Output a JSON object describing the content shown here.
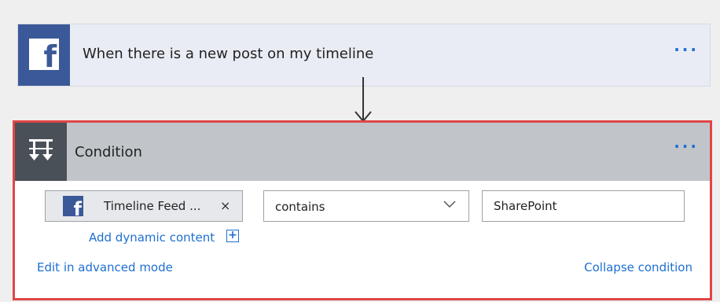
{
  "trigger": {
    "title": "When there is a new post on my timeline",
    "icon": "facebook-icon",
    "more": "···"
  },
  "condition": {
    "title": "Condition",
    "icon": "condition-icon",
    "more": "···",
    "left_token": {
      "label": "Timeline Feed ...",
      "remove": "×",
      "icon": "facebook-icon"
    },
    "operator": {
      "value": "contains"
    },
    "right_value": "SharePoint",
    "add_dynamic_content": "Add dynamic content",
    "add_dynamic_icon": "+",
    "edit_advanced": "Edit in advanced mode",
    "collapse": "Collapse condition"
  },
  "colors": {
    "facebook_blue": "#3b5998",
    "link_blue": "#1e6fd0",
    "highlight_red": "#e04646",
    "condition_header": "#c1c5c9"
  }
}
